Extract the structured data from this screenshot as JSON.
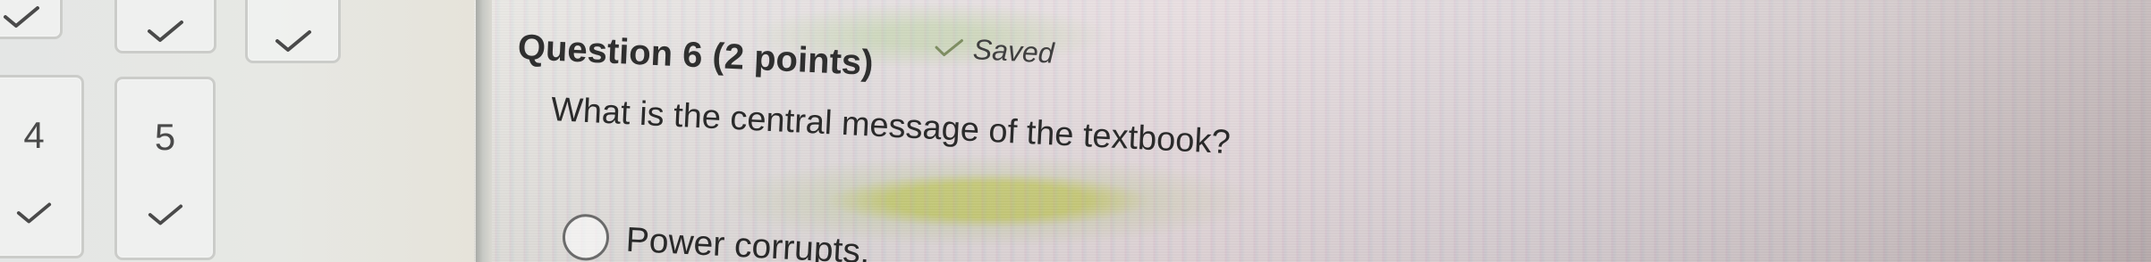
{
  "question_nav": {
    "top_items": [
      {
        "status_icon": "checkmark-icon",
        "status": "answered"
      },
      {
        "status_icon": "checkmark-icon",
        "status": "answered"
      },
      {
        "status_icon": "checkmark-icon",
        "status": "answered"
      }
    ],
    "items": [
      {
        "number": "4",
        "status_icon": "checkmark-icon",
        "status": "answered"
      },
      {
        "number": "5",
        "status_icon": "checkmark-icon",
        "status": "answered"
      }
    ]
  },
  "question": {
    "title": "Question 6 (2 points)",
    "saved_label": "Saved",
    "prompt": "What is the central message of the textbook?",
    "answers": [
      {
        "label": "Power corrupts."
      }
    ]
  },
  "colors": {
    "check": "#4a4a4a",
    "text": "#2a2a2a",
    "border": "#cbccc9",
    "screen_green_glare": "#c9e028",
    "screen_pink_tint": "#e2d5d8"
  }
}
